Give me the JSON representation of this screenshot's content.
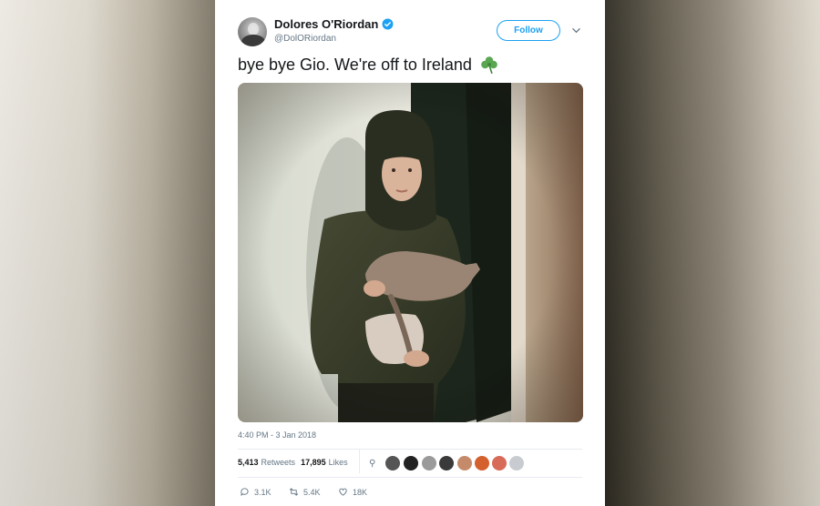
{
  "tweet": {
    "display_name": "Dolores O'Riordan",
    "handle": "@DolORiordan",
    "follow_label": "Follow",
    "text": "bye bye Gio. We're off to Ireland",
    "emoji": "shamrock",
    "timestamp": "4:40 PM - 3 Jan 2018",
    "photo_description_icon": "tweet-photo"
  },
  "stats": {
    "retweets_count": "5,413",
    "retweets_label": "Retweets",
    "likes_count": "17,895",
    "likes_label": "Likes"
  },
  "actions": {
    "replies": "3.1K",
    "retweets": "5.4K",
    "likes": "18K"
  },
  "colors": {
    "accent": "#1da1f2",
    "verified": "#1da1f2",
    "secondary_text": "#657786",
    "primary_text": "#14171a"
  },
  "liker_avatar_colors": [
    "#555555",
    "#222222",
    "#9a9a9a",
    "#3a3a3a",
    "#c58a6a",
    "#d4602e",
    "#d86a5a",
    "#c8ccd0"
  ]
}
